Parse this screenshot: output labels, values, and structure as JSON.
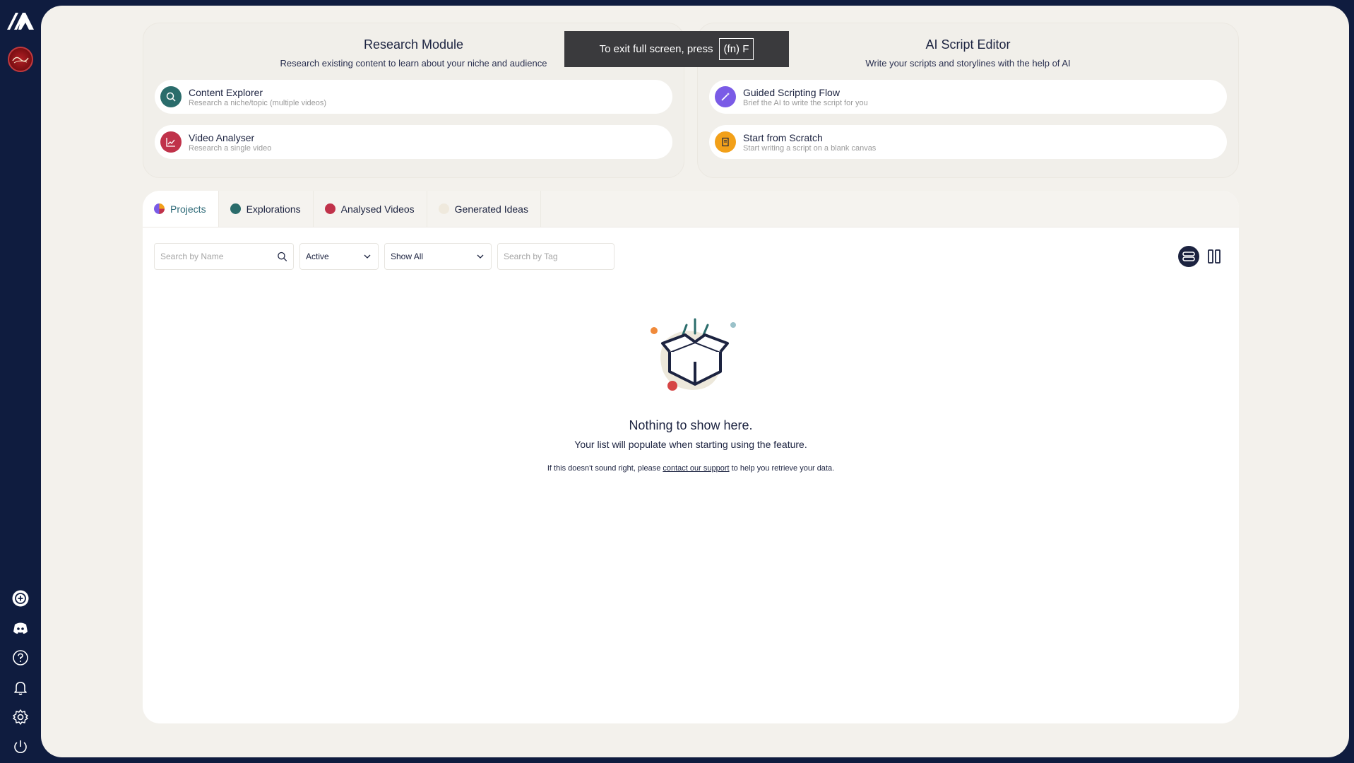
{
  "toast": {
    "text": "To exit full screen, press",
    "key": "(fn) F"
  },
  "research": {
    "title": "Research Module",
    "subtitle": "Research existing content to learn about your niche and audience",
    "options": [
      {
        "title": "Content Explorer",
        "desc": "Research a niche/topic (multiple videos)",
        "icon": "search-icon",
        "color": "#2a6c6b"
      },
      {
        "title": "Video Analyser",
        "desc": "Research a single video",
        "icon": "chart-icon",
        "color": "#c0324a"
      }
    ]
  },
  "script_editor": {
    "title": "AI Script Editor",
    "subtitle": "Write your scripts and storylines with the help of AI",
    "options": [
      {
        "title": "Guided Scripting Flow",
        "desc": "Brief the AI to write the script for you",
        "icon": "magic-wand-icon",
        "color": "#7a5be6"
      },
      {
        "title": "Start from Scratch",
        "desc": "Start writing a script on a blank canvas",
        "icon": "document-icon",
        "color": "#f2a019"
      }
    ]
  },
  "tabs": [
    {
      "label": "Projects",
      "color": "#7a5be6"
    },
    {
      "label": "Explorations",
      "color": "#2a6c6b"
    },
    {
      "label": "Analysed Videos",
      "color": "#c0324a"
    },
    {
      "label": "Generated Ideas",
      "color": "#efe9dd"
    }
  ],
  "filters": {
    "name_placeholder": "Search by Name",
    "status_value": "Active",
    "show_value": "Show All",
    "tag_placeholder": "Search by Tag"
  },
  "empty": {
    "title": "Nothing to show here.",
    "subtitle": "Your list will populate when starting using the feature.",
    "help_before": "If this doesn't sound right, please",
    "help_link": "contact our support",
    "help_after": "to help you retrieve your data."
  },
  "colors": {
    "rail": "#0f1c3f",
    "panel": "#f3f1ec",
    "accent": "#2e6a78"
  }
}
